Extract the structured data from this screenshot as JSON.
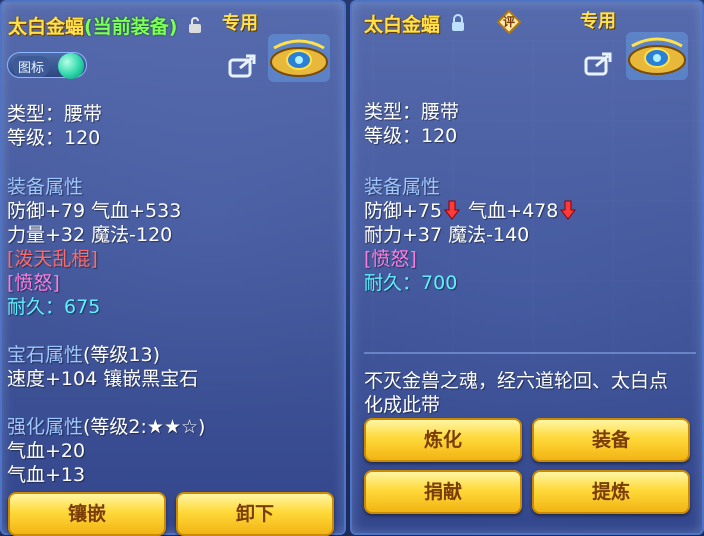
{
  "left_panel": {
    "title": "太白金蝠",
    "current_tag": "(当前装备)",
    "special": "专用",
    "toggle_label": "图标",
    "type": "类型：腰带",
    "level": "等级：120",
    "attr_header": "装备属性",
    "attr_line1": "防御+79 气血+533",
    "attr_line2": "力量+32 魔法-120",
    "special_skill": "[泼天乱棍]",
    "special_effect": "[愤怒]",
    "durability_label": "耐久：",
    "durability_value": "675",
    "gem_header": "宝石属性",
    "gem_level": "(等级13)",
    "gem_line": "速度+104 镶嵌黑宝石",
    "enhance_header": "强化属性",
    "enhance_level": "(等级2:★★☆)",
    "enhance_line1": "气血+20",
    "enhance_line2": "气血+13",
    "btn_inlay": "镶嵌",
    "btn_unequip": "卸下"
  },
  "right_panel": {
    "title": "太白金蝠",
    "ping": "评",
    "special": "专用",
    "type": "类型：腰带",
    "level": "等级：120",
    "attr_header": "装备属性",
    "def_text": "防御+75",
    "hp_text": "气血+478",
    "attr_line2": "耐力+37 魔法-140",
    "special_effect": "[愤怒]",
    "durability_label": "耐久：",
    "durability_value": "700",
    "desc_line1": "不灭金兽之魂，经六道轮回、太白点",
    "desc_line2": "化成此带",
    "btn_refine": "炼化",
    "btn_equip": "装备",
    "btn_donate": "捐献",
    "btn_extract": "提炼"
  },
  "icons": [
    "lock-open-icon",
    "lock-closed-icon",
    "share-icon",
    "belt-item-icon",
    "down-arrow-icon"
  ],
  "colors": {
    "title": "#ffe14a",
    "current": "#7dff5a",
    "section": "#9ec6ff",
    "skill": "#ff6a6a",
    "effect": "#ff7de0",
    "durability": "#5ef0ff",
    "button": "#ffd93a"
  }
}
